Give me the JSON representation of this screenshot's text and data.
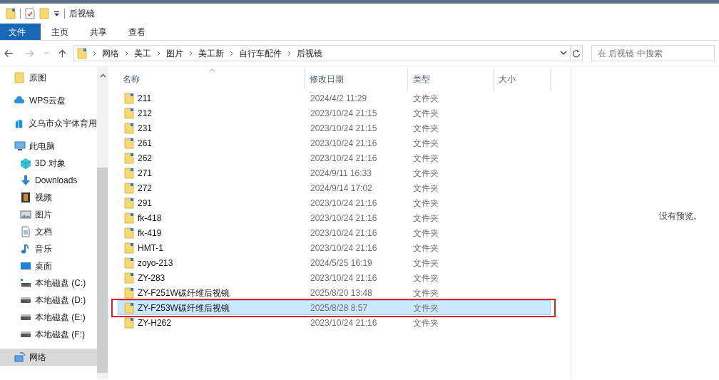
{
  "window": {
    "title": "后视镜"
  },
  "ribbon_tabs": [
    {
      "label": "文件",
      "selected": true
    },
    {
      "label": "主页",
      "selected": false
    },
    {
      "label": "共享",
      "selected": false
    },
    {
      "label": "查看",
      "selected": false
    }
  ],
  "address_bar": {
    "path": [
      "网络",
      "美工",
      "图片",
      "美工新",
      "自行车配件",
      "后视镜"
    ]
  },
  "search": {
    "placeholder": "在 后视镜 中搜索"
  },
  "sidebar": {
    "items": [
      {
        "label": "原图",
        "kind": "folder",
        "selected": false
      },
      {
        "label": "WPS云盘",
        "kind": "cloud",
        "selected": false
      },
      {
        "label": "义乌市众宇体育用",
        "kind": "org",
        "selected": false
      },
      {
        "label": "此电脑",
        "kind": "pc",
        "selected": false,
        "children": [
          {
            "label": "3D 对象",
            "kind": "cube",
            "selected": false
          },
          {
            "label": "Downloads",
            "kind": "download",
            "selected": false
          },
          {
            "label": "视频",
            "kind": "video",
            "selected": false
          },
          {
            "label": "图片",
            "kind": "image",
            "selected": false
          },
          {
            "label": "文档",
            "kind": "doc",
            "selected": false
          },
          {
            "label": "音乐",
            "kind": "music",
            "selected": false
          },
          {
            "label": "桌面",
            "kind": "desktop",
            "selected": false
          },
          {
            "label": "本地磁盘 (C:)",
            "kind": "sysdrive",
            "selected": false
          },
          {
            "label": "本地磁盘 (D:)",
            "kind": "drive",
            "selected": false
          },
          {
            "label": "本地磁盘 (E:)",
            "kind": "drive",
            "selected": false
          },
          {
            "label": "本地磁盘 (F:)",
            "kind": "drive",
            "selected": false
          }
        ]
      },
      {
        "label": "网络",
        "kind": "network",
        "selected": true
      }
    ]
  },
  "table": {
    "columns": [
      "名称",
      "修改日期",
      "类型",
      "大小"
    ],
    "rows": [
      {
        "name": "211",
        "modified": "2024/4/2 11:29",
        "type": "文件夹",
        "selected": false,
        "outlined": false
      },
      {
        "name": "212",
        "modified": "2023/10/24 21:15",
        "type": "文件夹",
        "selected": false,
        "outlined": false
      },
      {
        "name": "231",
        "modified": "2023/10/24 21:15",
        "type": "文件夹",
        "selected": false,
        "outlined": false
      },
      {
        "name": "261",
        "modified": "2023/10/24 21:16",
        "type": "文件夹",
        "selected": false,
        "outlined": false
      },
      {
        "name": "262",
        "modified": "2023/10/24 21:16",
        "type": "文件夹",
        "selected": false,
        "outlined": false
      },
      {
        "name": "271",
        "modified": "2024/9/11 16:33",
        "type": "文件夹",
        "selected": false,
        "outlined": false
      },
      {
        "name": "272",
        "modified": "2024/9/14 17:02",
        "type": "文件夹",
        "selected": false,
        "outlined": false
      },
      {
        "name": "291",
        "modified": "2023/10/24 21:16",
        "type": "文件夹",
        "selected": false,
        "outlined": false
      },
      {
        "name": "fk-418",
        "modified": "2023/10/24 21:16",
        "type": "文件夹",
        "selected": false,
        "outlined": false
      },
      {
        "name": "fk-419",
        "modified": "2023/10/24 21:16",
        "type": "文件夹",
        "selected": false,
        "outlined": false
      },
      {
        "name": "HMT-1",
        "modified": "2023/10/24 21:16",
        "type": "文件夹",
        "selected": false,
        "outlined": false
      },
      {
        "name": "zoyo-213",
        "modified": "2024/5/25 16:19",
        "type": "文件夹",
        "selected": false,
        "outlined": false
      },
      {
        "name": "ZY-283",
        "modified": "2023/10/24 21:16",
        "type": "文件夹",
        "selected": false,
        "outlined": false
      },
      {
        "name": "ZY-F251W碳纤维后视镜",
        "modified": "2025/8/20 13:48",
        "type": "文件夹",
        "selected": false,
        "outlined": false
      },
      {
        "name": "ZY-F253W碳纤维后视镜",
        "modified": "2025/8/28 8:57",
        "type": "文件夹",
        "selected": true,
        "outlined": true
      },
      {
        "name": "ZY-H262",
        "modified": "2023/10/24 21:16",
        "type": "文件夹",
        "selected": false,
        "outlined": false
      }
    ]
  },
  "preview": {
    "message": "没有预览。"
  }
}
